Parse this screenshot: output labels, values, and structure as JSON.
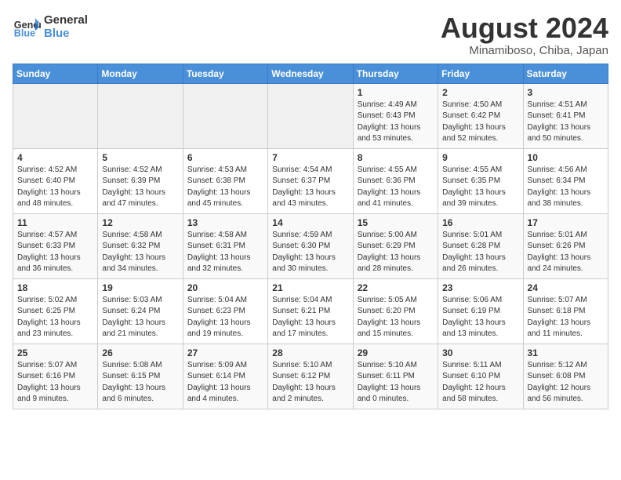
{
  "header": {
    "logo_line1": "General",
    "logo_line2": "Blue",
    "month_year": "August 2024",
    "location": "Minamiboso, Chiba, Japan"
  },
  "days_of_week": [
    "Sunday",
    "Monday",
    "Tuesday",
    "Wednesday",
    "Thursday",
    "Friday",
    "Saturday"
  ],
  "weeks": [
    [
      {
        "day": "",
        "info": ""
      },
      {
        "day": "",
        "info": ""
      },
      {
        "day": "",
        "info": ""
      },
      {
        "day": "",
        "info": ""
      },
      {
        "day": "1",
        "info": "Sunrise: 4:49 AM\nSunset: 6:43 PM\nDaylight: 13 hours\nand 53 minutes."
      },
      {
        "day": "2",
        "info": "Sunrise: 4:50 AM\nSunset: 6:42 PM\nDaylight: 13 hours\nand 52 minutes."
      },
      {
        "day": "3",
        "info": "Sunrise: 4:51 AM\nSunset: 6:41 PM\nDaylight: 13 hours\nand 50 minutes."
      }
    ],
    [
      {
        "day": "4",
        "info": "Sunrise: 4:52 AM\nSunset: 6:40 PM\nDaylight: 13 hours\nand 48 minutes."
      },
      {
        "day": "5",
        "info": "Sunrise: 4:52 AM\nSunset: 6:39 PM\nDaylight: 13 hours\nand 47 minutes."
      },
      {
        "day": "6",
        "info": "Sunrise: 4:53 AM\nSunset: 6:38 PM\nDaylight: 13 hours\nand 45 minutes."
      },
      {
        "day": "7",
        "info": "Sunrise: 4:54 AM\nSunset: 6:37 PM\nDaylight: 13 hours\nand 43 minutes."
      },
      {
        "day": "8",
        "info": "Sunrise: 4:55 AM\nSunset: 6:36 PM\nDaylight: 13 hours\nand 41 minutes."
      },
      {
        "day": "9",
        "info": "Sunrise: 4:55 AM\nSunset: 6:35 PM\nDaylight: 13 hours\nand 39 minutes."
      },
      {
        "day": "10",
        "info": "Sunrise: 4:56 AM\nSunset: 6:34 PM\nDaylight: 13 hours\nand 38 minutes."
      }
    ],
    [
      {
        "day": "11",
        "info": "Sunrise: 4:57 AM\nSunset: 6:33 PM\nDaylight: 13 hours\nand 36 minutes."
      },
      {
        "day": "12",
        "info": "Sunrise: 4:58 AM\nSunset: 6:32 PM\nDaylight: 13 hours\nand 34 minutes."
      },
      {
        "day": "13",
        "info": "Sunrise: 4:58 AM\nSunset: 6:31 PM\nDaylight: 13 hours\nand 32 minutes."
      },
      {
        "day": "14",
        "info": "Sunrise: 4:59 AM\nSunset: 6:30 PM\nDaylight: 13 hours\nand 30 minutes."
      },
      {
        "day": "15",
        "info": "Sunrise: 5:00 AM\nSunset: 6:29 PM\nDaylight: 13 hours\nand 28 minutes."
      },
      {
        "day": "16",
        "info": "Sunrise: 5:01 AM\nSunset: 6:28 PM\nDaylight: 13 hours\nand 26 minutes."
      },
      {
        "day": "17",
        "info": "Sunrise: 5:01 AM\nSunset: 6:26 PM\nDaylight: 13 hours\nand 24 minutes."
      }
    ],
    [
      {
        "day": "18",
        "info": "Sunrise: 5:02 AM\nSunset: 6:25 PM\nDaylight: 13 hours\nand 23 minutes."
      },
      {
        "day": "19",
        "info": "Sunrise: 5:03 AM\nSunset: 6:24 PM\nDaylight: 13 hours\nand 21 minutes."
      },
      {
        "day": "20",
        "info": "Sunrise: 5:04 AM\nSunset: 6:23 PM\nDaylight: 13 hours\nand 19 minutes."
      },
      {
        "day": "21",
        "info": "Sunrise: 5:04 AM\nSunset: 6:21 PM\nDaylight: 13 hours\nand 17 minutes."
      },
      {
        "day": "22",
        "info": "Sunrise: 5:05 AM\nSunset: 6:20 PM\nDaylight: 13 hours\nand 15 minutes."
      },
      {
        "day": "23",
        "info": "Sunrise: 5:06 AM\nSunset: 6:19 PM\nDaylight: 13 hours\nand 13 minutes."
      },
      {
        "day": "24",
        "info": "Sunrise: 5:07 AM\nSunset: 6:18 PM\nDaylight: 13 hours\nand 11 minutes."
      }
    ],
    [
      {
        "day": "25",
        "info": "Sunrise: 5:07 AM\nSunset: 6:16 PM\nDaylight: 13 hours\nand 9 minutes."
      },
      {
        "day": "26",
        "info": "Sunrise: 5:08 AM\nSunset: 6:15 PM\nDaylight: 13 hours\nand 6 minutes."
      },
      {
        "day": "27",
        "info": "Sunrise: 5:09 AM\nSunset: 6:14 PM\nDaylight: 13 hours\nand 4 minutes."
      },
      {
        "day": "28",
        "info": "Sunrise: 5:10 AM\nSunset: 6:12 PM\nDaylight: 13 hours\nand 2 minutes."
      },
      {
        "day": "29",
        "info": "Sunrise: 5:10 AM\nSunset: 6:11 PM\nDaylight: 13 hours\nand 0 minutes."
      },
      {
        "day": "30",
        "info": "Sunrise: 5:11 AM\nSunset: 6:10 PM\nDaylight: 12 hours\nand 58 minutes."
      },
      {
        "day": "31",
        "info": "Sunrise: 5:12 AM\nSunset: 6:08 PM\nDaylight: 12 hours\nand 56 minutes."
      }
    ]
  ]
}
